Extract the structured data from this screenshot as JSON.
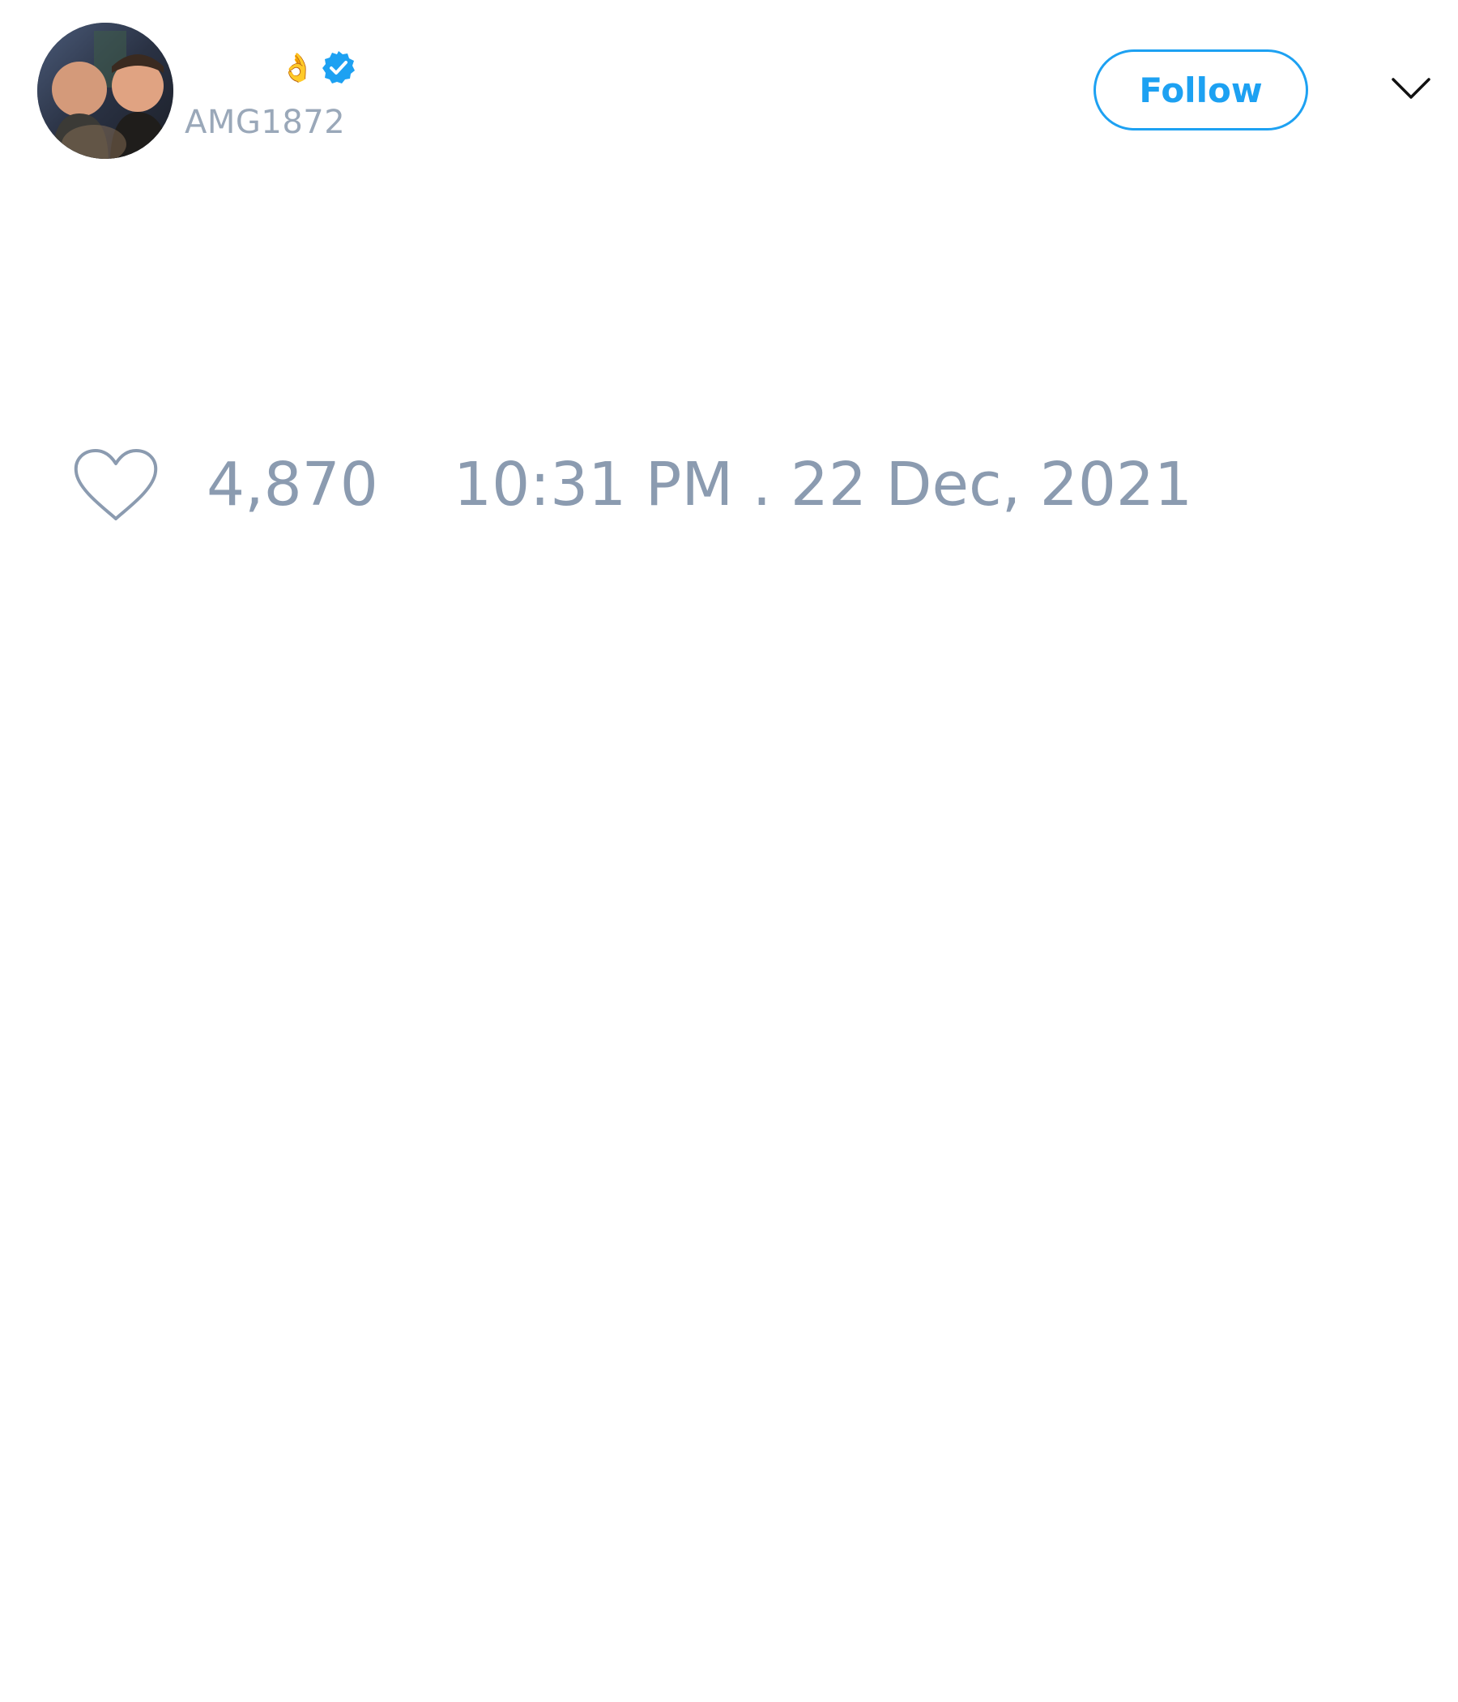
{
  "tweet": {
    "author": {
      "display_name": "",
      "name_emoji": "👌",
      "verified": true,
      "handle": "AMG1872",
      "avatar_icon": "profile-photo"
    },
    "follow_label": "Follow",
    "menu_icon": "chevron-down-icon",
    "likes": {
      "icon": "heart-outline-icon",
      "count": "4,870"
    },
    "timestamp": "10:31 PM . 22 Dec, 2021"
  },
  "colors": {
    "accent": "#1da1f2",
    "muted_text": "#8b9bb0",
    "handle_text": "#9aa8b9",
    "background": "#ffffff"
  }
}
